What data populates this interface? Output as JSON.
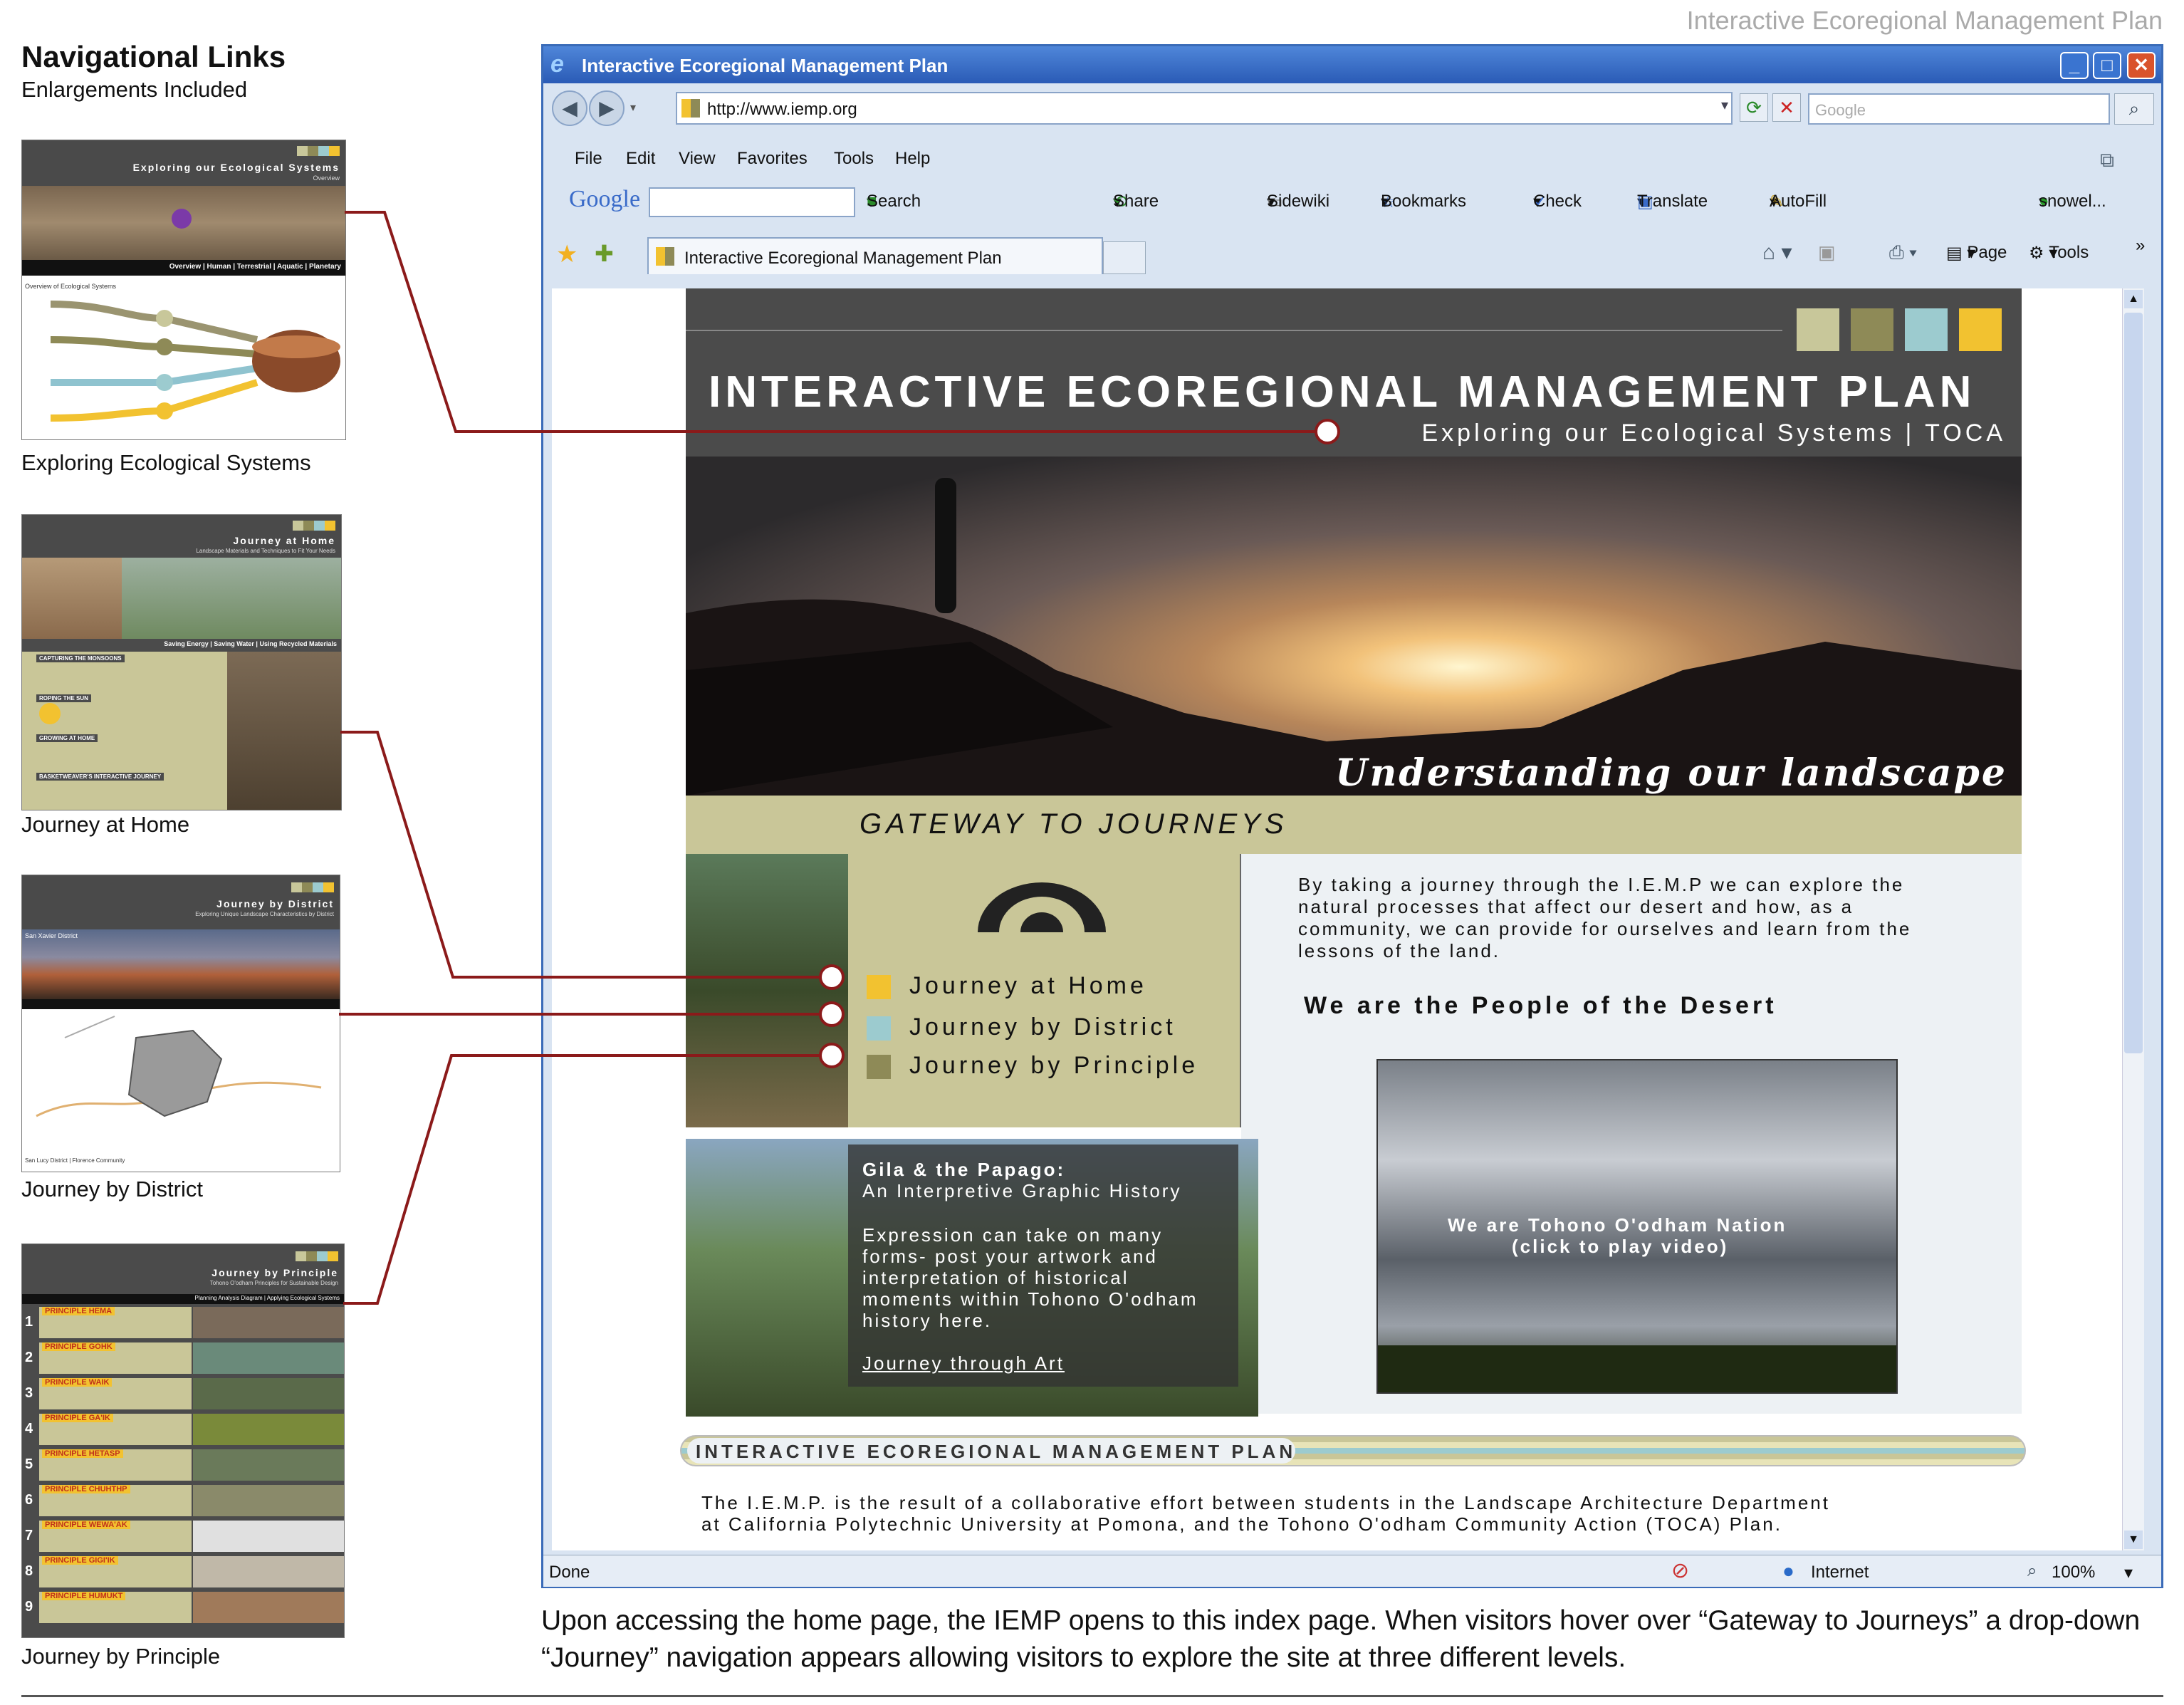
{
  "page": {
    "top_title": "Interactive Ecoregional Management Plan",
    "heading": "Navigational Links",
    "subheading": "Enlargements Included",
    "caption": "Upon accessing the home page, the IEMP opens to this index page. When visitors hover over “Gateway to Journeys” a drop-down “Journey” navigation appears allowing visitors to explore the site at three different levels."
  },
  "thumbnails": [
    {
      "caption": "Exploring Ecological Systems",
      "header": "Exploring our Ecological Systems",
      "header_sub": "Overview",
      "nav": "Overview | Human | Terrestrial | Aquatic | Planetary",
      "side_label": "Overview of Ecological Systems"
    },
    {
      "caption": "Journey at Home",
      "header": "Journey at Home",
      "header_sub": "Landscape Materials and Techniques to Fit Your Needs",
      "nav": "Saving Energy | Saving Water | Using Recycled Materials",
      "rows": [
        "CAPTURING THE MONSOONS",
        "ROPING THE SUN",
        "GROWING AT HOME",
        "BASKETWEAVER'S INTERACTIVE JOURNEY"
      ]
    },
    {
      "caption": "Journey by District",
      "header": "Journey by District",
      "header_sub": "Exploring Unique Landscape Characteristics by District",
      "place": "San Xavier District",
      "footer": "San Lucy District | Florence Community"
    },
    {
      "caption": "Journey by Principle",
      "header": "Journey by Principle",
      "header_sub": "Tohono O'odham Principles for Sustainable Design",
      "nav": "Planning Analysis Diagram | Applying Ecological Systems",
      "principles": [
        {
          "num": "1",
          "name": "PRINCIPLE HEMA"
        },
        {
          "num": "2",
          "name": "PRINCIPLE GOHK"
        },
        {
          "num": "3",
          "name": "PRINCIPLE WAIK"
        },
        {
          "num": "4",
          "name": "PRINCIPLE GA'IK"
        },
        {
          "num": "5",
          "name": "PRINCIPLE HETASP"
        },
        {
          "num": "6",
          "name": "PRINCIPLE CHUHTHP"
        },
        {
          "num": "7",
          "name": "PRINCIPLE WEWA'AK"
        },
        {
          "num": "8",
          "name": "PRINCIPLE GIGI'IK"
        },
        {
          "num": "9",
          "name": "PRINCIPLE HUMUKT"
        }
      ]
    }
  ],
  "browser": {
    "window_title": "Interactive Ecoregional Management Plan",
    "address": "http://www.iemp.org",
    "search_placeholder": "Google",
    "menu": [
      "File",
      "Edit",
      "View",
      "Favorites",
      "Tools",
      "Help"
    ],
    "google_bar": {
      "logo": "Google",
      "search": "Search",
      "share": "Share",
      "sidewiki": "Sidewiki",
      "bookmarks": "Bookmarks",
      "check": "Check",
      "translate": "Translate",
      "autofill": "AutoFill",
      "profile": "snowel..."
    },
    "tab_title": "Interactive Ecoregional Management Plan",
    "cmd": {
      "page": "Page",
      "tools": "Tools"
    },
    "status": {
      "left": "Done",
      "zone": "Internet",
      "zoom": "100%"
    }
  },
  "site": {
    "title": "INTERACTIVE ECOREGIONAL MANAGEMENT PLAN",
    "subtitle": "Exploring our Ecological Systems | TOCA",
    "hero_script": "Understanding our landscape",
    "gateway": "GATEWAY TO JOURNEYS",
    "journeys": [
      "Journey at Home",
      "Journey by District",
      "Journey by Principle"
    ],
    "intro": "By taking a journey through the I.E.M.P we can explore the natural processes that affect our desert and how, as a community, we can provide for ourselves and learn from the lessons of the land.",
    "tagline": "We are the People of the Desert",
    "gila_title": "Gila & the Papago:",
    "gila_sub": "An Interpretive Graphic History",
    "gila_body": "Expression can take on many forms- post your artwork and interpretation of historical moments within Tohono O'odham history here.",
    "gila_link": "Journey through Art",
    "video_caption_1": "We are Tohono O'odham Nation",
    "video_caption_2": "(click to play video)",
    "footer_banner": "INTERACTIVE ECOREGIONAL MANAGEMENT PLAN",
    "footer_text_1": "The I.E.M.P. is the result of a collaborative effort between students in the Landscape Architecture Department",
    "footer_text_2": "at California Polytechnic University at Pomona, and the Tohono O'odham Community Action (TOCA) Plan."
  },
  "colors": {
    "callout_line": "#8b1a1a",
    "sq_sage": "#c8c79a",
    "sq_olive": "#8e8a57",
    "sq_teal": "#9ccbcf",
    "sq_gold": "#f2c230",
    "khaki": "#c9c698",
    "dark_header": "#4b4b4b"
  }
}
